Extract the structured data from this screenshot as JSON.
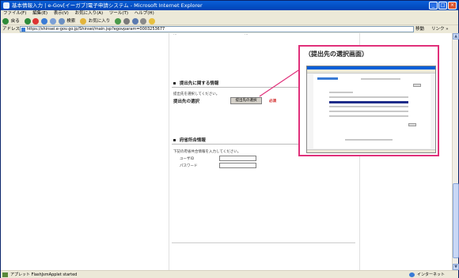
{
  "window": {
    "title": "基本情報入力 | e-Gov[イーガブ]電子申請システム - Microsoft Internet Explorer",
    "controls": [
      "_",
      "□",
      "×"
    ]
  },
  "menu": [
    "ファイル(F)",
    "編集(E)",
    "表示(V)",
    "お気に入り(A)",
    "ツール(T)",
    "ヘルプ(H)"
  ],
  "toolbar": {
    "back_label": "戻る",
    "search_label": "検索",
    "favorites_label": "お気に入り"
  },
  "address": {
    "label": "アドレス(D)",
    "url": "https://shinsei.e-gov.go.jp/Shinsei/main.jsp?egovparam=0003253677",
    "go_label": "移動",
    "links_label": "リンク »"
  },
  "page": {
    "top_fragment_left": "…",
    "top_fragment_right": "…",
    "submission": {
      "heading": "提出先に関する情報",
      "instruction": "提出先を選択してください。",
      "field_label": "提出先の選択",
      "select_button": "提出先の選択",
      "required": "必須"
    },
    "account": {
      "heading": "府省所合情報",
      "instruction": "下記の府省共合情報を入力してください。",
      "userid_label": "ユーザID",
      "password_label": "パスワード"
    }
  },
  "callout": {
    "title": "（提出先の選択画面）"
  },
  "status": {
    "text": "アプレット FlashJsmApplet started",
    "zone": "インターネット"
  },
  "colors": {
    "callout_border": "#e0307a",
    "titlebar": "#0a5fd8",
    "required": "#d02020"
  }
}
